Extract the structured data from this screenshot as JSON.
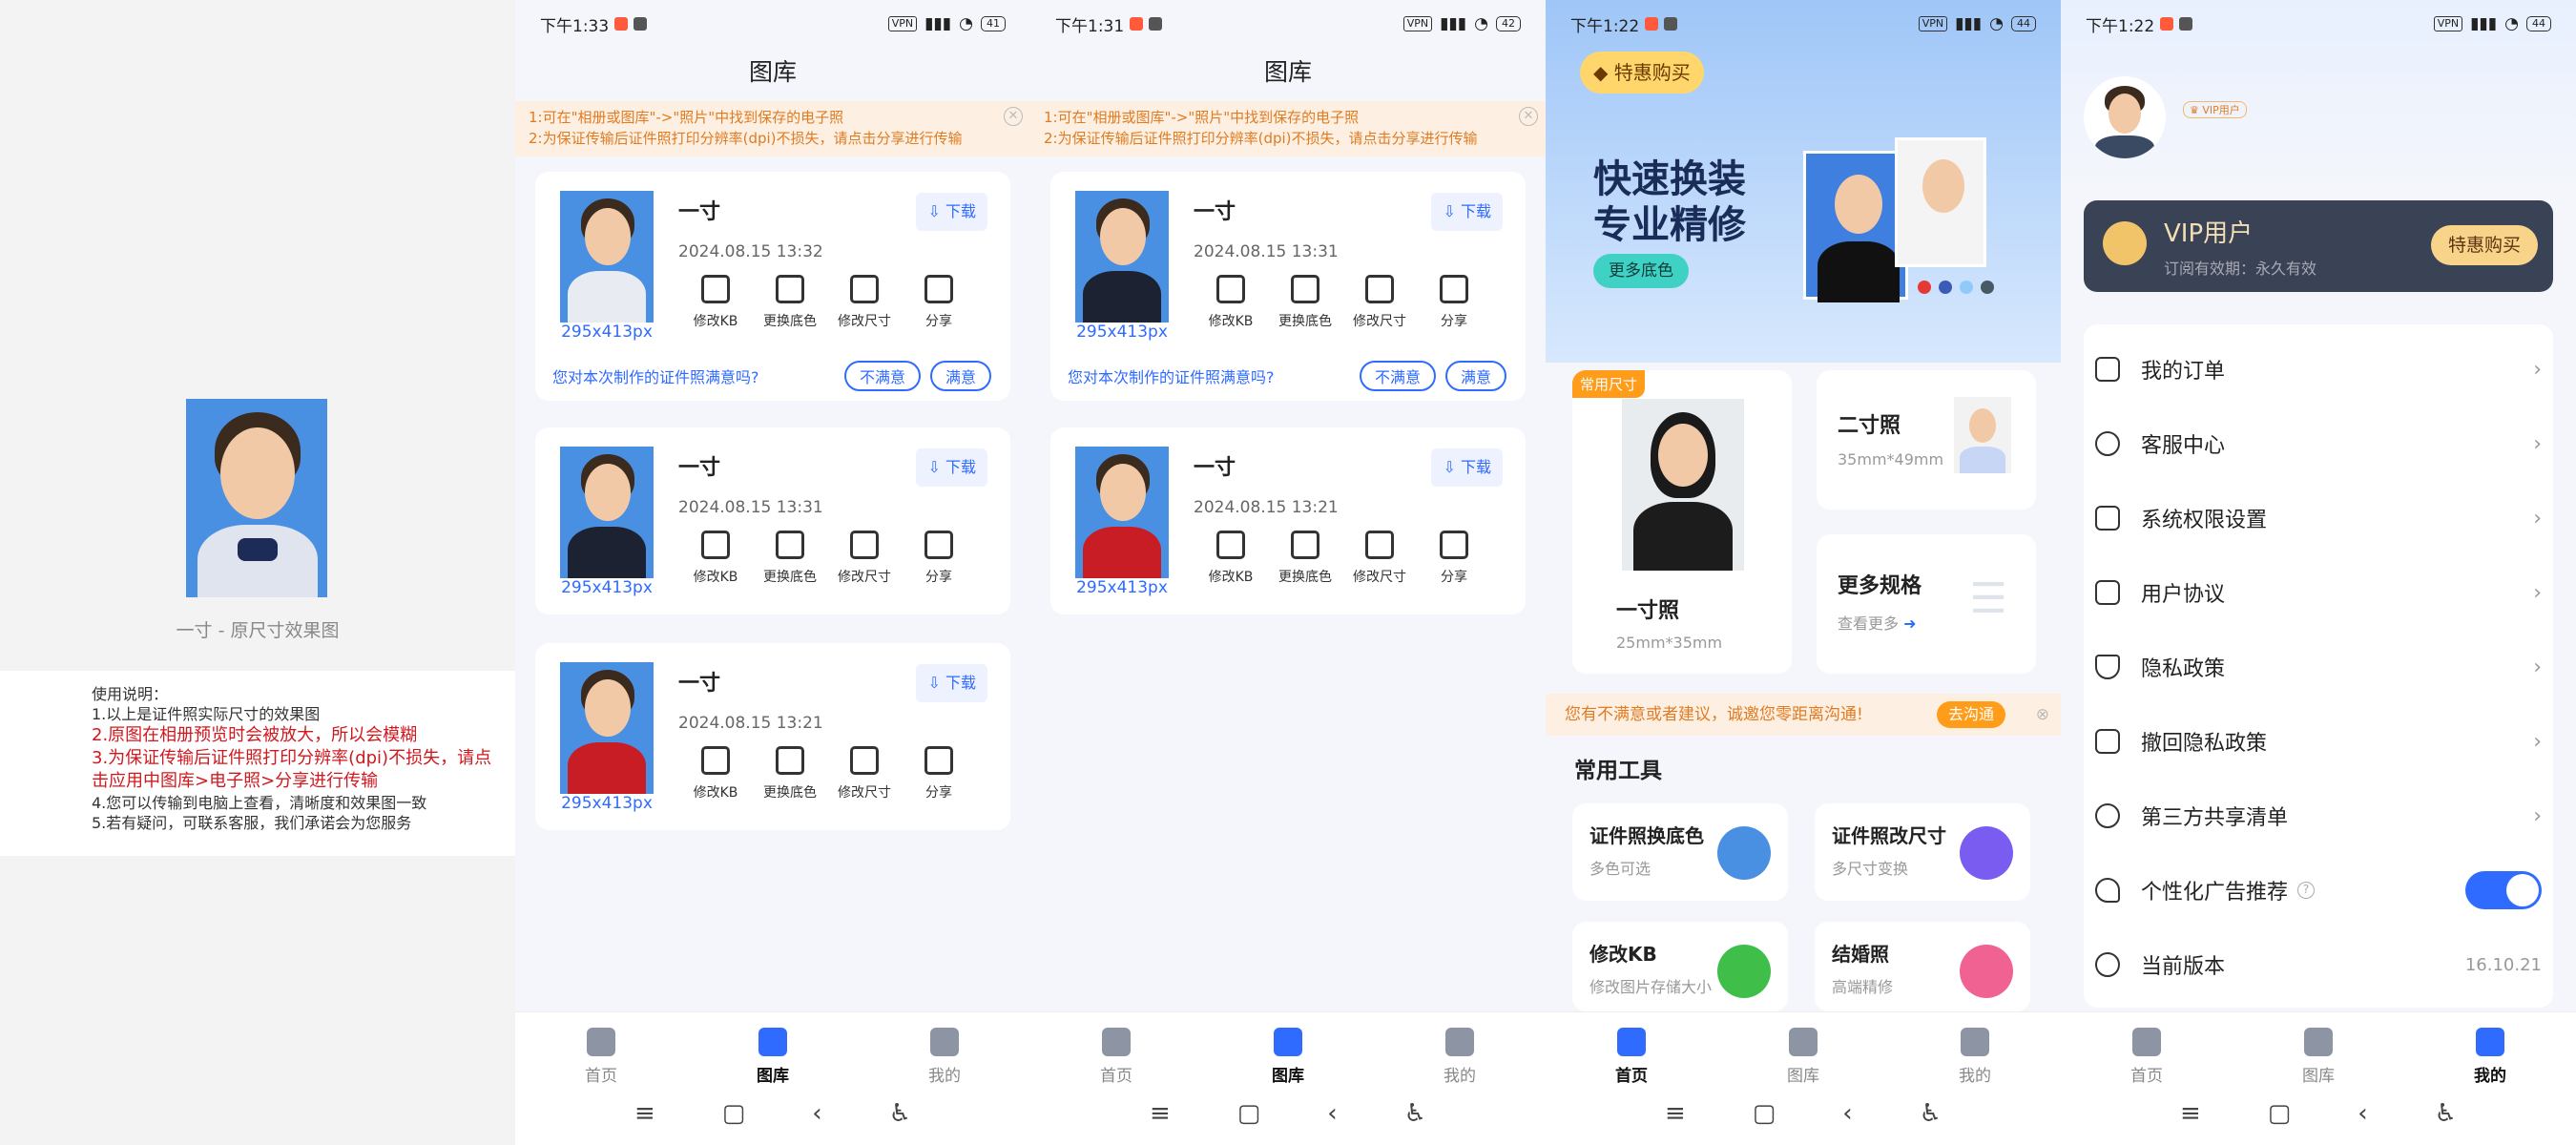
{
  "status": {
    "time1": "下午1:33",
    "time2": "下午1:31",
    "time3": "下午1:22",
    "time4": "下午1:22",
    "battery1": "41",
    "battery2": "42",
    "battery3": "44",
    "battery4": "44"
  },
  "p1": {
    "caption": "一寸 - 原尺寸效果图",
    "lines": [
      "使用说明：",
      "1.以上是证件照实际尺寸的效果图"
    ],
    "red": [
      "2.原图在相册预览时会被放大，所以会模糊",
      "3.为保证传输后证件照打印分辨率(dpi)不损失，请点击应用中图库>电子照>分享进行传输"
    ],
    "tail": [
      "4.您可以传输到电脑上查看，清晰度和效果图一致",
      "5.若有疑问，可联系客服，我们承诺会为您服务"
    ]
  },
  "gallery": {
    "title": "图库",
    "notice1": "1:可在\"相册或图库\"->\"照片\"中找到保存的电子照",
    "notice2": "2:为保证传输后证件照打印分辨率(dpi)不损失，请点击分享进行传输",
    "download": "下载",
    "dim": "295x413px",
    "tools": [
      "修改KB",
      "更换底色",
      "修改尺寸",
      "分享"
    ],
    "feedback_q": "您对本次制作的证件照满意吗?",
    "unsatisfied": "不满意",
    "satisfied": "满意",
    "name": "一寸",
    "cards2": [
      "2024.08.15 13:32",
      "2024.08.15 13:31",
      "2024.08.15 13:21"
    ],
    "cards3": [
      "2024.08.15 13:31",
      "2024.08.15 13:21"
    ]
  },
  "nav": {
    "home": "首页",
    "gallery": "图库",
    "mine": "我的"
  },
  "p4": {
    "vip_chip": "特惠购买",
    "big1": "快速换装",
    "big2": "专业精修",
    "more_color": "更多底色",
    "common_tag": "常用尺寸",
    "one": "一寸照",
    "one_size": "25mm*35mm",
    "two": "二寸照",
    "two_size": "35mm*49mm",
    "more": "更多规格",
    "more_sub": "查看更多",
    "tips": "您有不满意或者建议，诚邀您零距离沟通!",
    "tips_btn": "去沟通",
    "tools_title": "常用工具",
    "tools": [
      {
        "t": "证件照换底色",
        "s": "多色可选"
      },
      {
        "t": "证件照改尺寸",
        "s": "多尺寸变换"
      },
      {
        "t": "修改KB",
        "s": "修改图片存储大小"
      },
      {
        "t": "结婚照",
        "s": "高端精修"
      }
    ]
  },
  "p5": {
    "vip_badge": "VIP用户",
    "vip_title": "VIP用户",
    "vip_sub": "订阅有效期：永久有效",
    "vip_btn": "特惠购买",
    "menu": [
      "我的订单",
      "客服中心",
      "系统权限设置",
      "用户协议",
      "隐私政策",
      "撤回隐私政策",
      "第三方共享清单",
      "个性化广告推荐",
      "当前版本"
    ],
    "version": "16.10.21"
  },
  "colors": {
    "accent": "#2f6bff",
    "notice": "#e07b22",
    "red": "#d0181f"
  }
}
